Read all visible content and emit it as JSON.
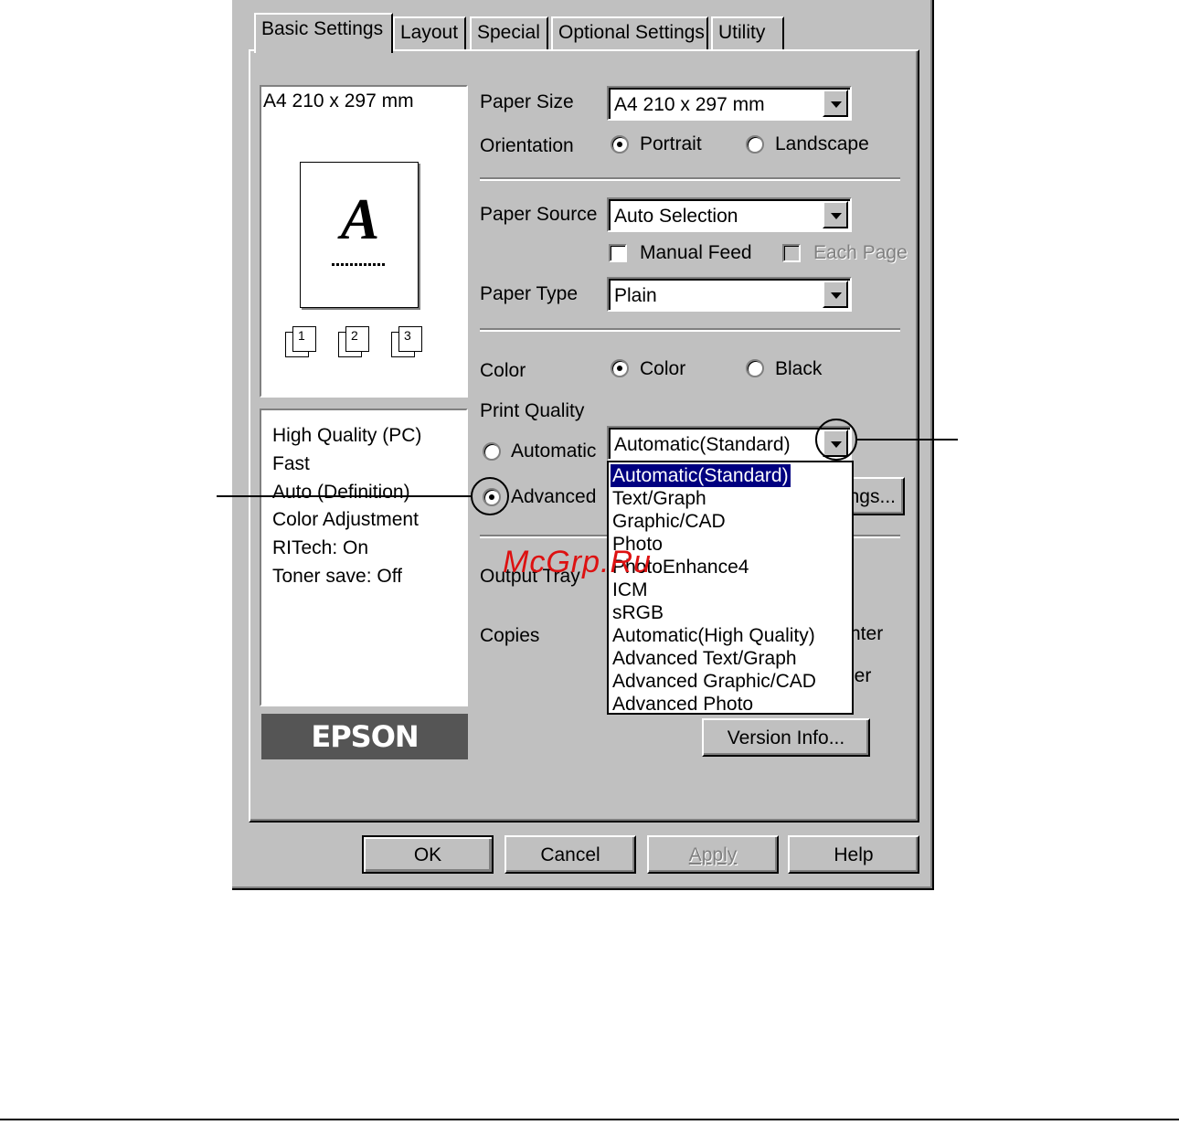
{
  "tabs": [
    {
      "label": "Basic Settings"
    },
    {
      "label": "Layout"
    },
    {
      "label": "Special"
    },
    {
      "label": "Optional Settings"
    },
    {
      "label": "Utility"
    }
  ],
  "preview": {
    "paper_label": "A4 210 x 297 mm",
    "glyph": "A",
    "page_icons": [
      "1",
      "2",
      "3"
    ]
  },
  "summary": [
    "High Quality (PC)",
    "Fast",
    "Auto (Definition)",
    "Color Adjustment",
    "RITech: On",
    "Toner save: Off"
  ],
  "paper_size": {
    "label": "Paper Size",
    "value": "A4 210 x 297 mm"
  },
  "orientation": {
    "label": "Orientation",
    "portrait": "Portrait",
    "landscape": "Landscape",
    "selected": "Portrait"
  },
  "paper_source": {
    "label": "Paper Source",
    "value": "Auto Selection"
  },
  "manual_feed": {
    "label": "Manual Feed",
    "checked": false
  },
  "each_page": {
    "label": "Each Page",
    "checked": false,
    "enabled": false
  },
  "paper_type": {
    "label": "Paper Type",
    "value": "Plain"
  },
  "color": {
    "label": "Color",
    "color_option": "Color",
    "black_option": "Black",
    "selected": "Color"
  },
  "print_quality": {
    "label": "Print Quality",
    "automatic_label": "Automatic",
    "advanced_label": "Advanced",
    "selected": "Advanced",
    "combo_value": "Automatic(Standard)",
    "settings_button_partial": "ngs...",
    "options": [
      "Automatic(Standard)",
      "Text/Graph",
      "Graphic/CAD",
      "Photo",
      "PhotoEnhance4",
      "ICM",
      "sRGB",
      "Automatic(High Quality)",
      "Advanced Text/Graph",
      "Advanced Graphic/CAD",
      "Advanced Photo"
    ],
    "highlighted_option": "Automatic(Standard)"
  },
  "output_tray": {
    "label": "Output Tray"
  },
  "copies": {
    "label": "Copies",
    "partial_right_1": "nter",
    "partial_right_2": "ler"
  },
  "version_info": {
    "label": "Version Info..."
  },
  "logo": {
    "text": "EPSON"
  },
  "watermark": {
    "text": "McGrp.Ru"
  },
  "buttons": {
    "ok": "OK",
    "cancel": "Cancel",
    "apply": "Apply",
    "help": "Help"
  }
}
